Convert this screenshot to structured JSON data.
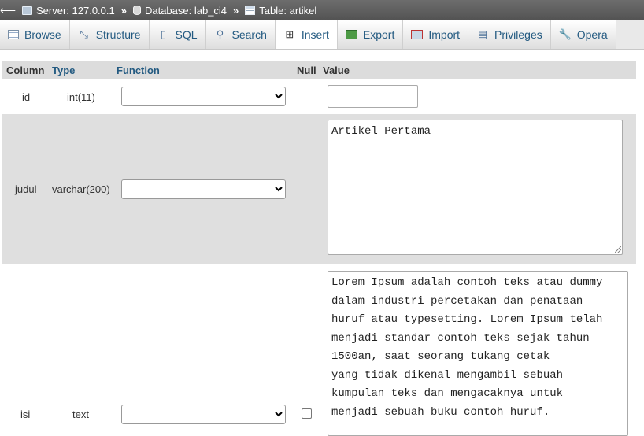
{
  "breadcrumb": {
    "back": "⟵",
    "server": "Server: 127.0.0.1",
    "database": "Database: lab_ci4",
    "table": "Table: artikel",
    "separator": "»"
  },
  "tabs": [
    {
      "label": "Browse",
      "icon": "browse-icon"
    },
    {
      "label": "Structure",
      "icon": "structure-icon"
    },
    {
      "label": "SQL",
      "icon": "sql-icon"
    },
    {
      "label": "Search",
      "icon": "search-icon"
    },
    {
      "label": "Insert",
      "icon": "insert-icon",
      "active": true
    },
    {
      "label": "Export",
      "icon": "export-icon"
    },
    {
      "label": "Import",
      "icon": "import-icon"
    },
    {
      "label": "Privileges",
      "icon": "privileges-icon"
    },
    {
      "label": "Opera",
      "icon": "operations-icon"
    }
  ],
  "headers": {
    "column": "Column",
    "type": "Type",
    "function": "Function",
    "null": "Null",
    "value": "Value"
  },
  "rows": [
    {
      "column": "id",
      "type": "int(11)",
      "function": "",
      "value": ""
    },
    {
      "column": "judul",
      "type": "varchar(200)",
      "function": "",
      "value": "Artikel Pertama"
    },
    {
      "column": "isi",
      "type": "text",
      "function": "",
      "value": "Lorem Ipsum adalah contoh teks atau dummy\ndalam industri percetakan dan penataan\nhuruf atau typesetting. Lorem Ipsum telah\nmenjadi standar contoh teks sejak tahun\n1500an, saat seorang tukang cetak\nyang tidak dikenal mengambil sebuah\nkumpulan teks dan mengacaknya untuk\nmenjadi sebuah buku contoh huruf."
    }
  ],
  "colors": {
    "link": "#235a81",
    "breadcrumb_bg": "#5f5f5f",
    "alt_row": "#dfdfdf",
    "header_bg": "#dcdcdc"
  }
}
